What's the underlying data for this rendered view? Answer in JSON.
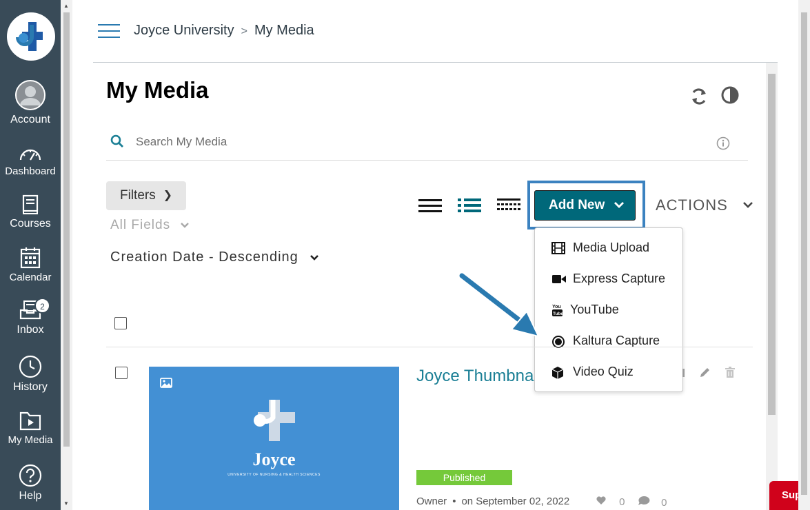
{
  "colors": {
    "nav_bg": "#394b58",
    "accent_teal": "#00687a",
    "link_teal": "#1b7f95",
    "highlight_blue": "#3b82c0",
    "published_green": "#75c93a",
    "thumbnail_blue": "#4390d4"
  },
  "global_nav": {
    "logo_icon": "joyce-cross-logo",
    "items": [
      {
        "label": "Account",
        "icon": "avatar-icon"
      },
      {
        "label": "Dashboard",
        "icon": "speedometer-icon"
      },
      {
        "label": "Courses",
        "icon": "book-icon"
      },
      {
        "label": "Calendar",
        "icon": "calendar-icon"
      },
      {
        "label": "Inbox",
        "icon": "inbox-icon",
        "badge": "2"
      },
      {
        "label": "History",
        "icon": "clock-icon"
      },
      {
        "label": "My Media",
        "icon": "media-folder-icon"
      },
      {
        "label": "Help",
        "icon": "help-icon"
      }
    ]
  },
  "header": {
    "breadcrumb": [
      "Joyce University",
      "My Media"
    ],
    "separator": ">"
  },
  "main": {
    "title": "My Media",
    "search": {
      "placeholder": "Search My Media"
    },
    "filters_label": "Filters",
    "field_select": "All Fields",
    "sort_select": "Creation Date - Descending",
    "add_new_label": "Add New",
    "actions_label": "ACTIONS",
    "add_new_menu": [
      {
        "label": "Media Upload",
        "icon": "film-icon"
      },
      {
        "label": "Express Capture",
        "icon": "video-camera-icon"
      },
      {
        "label": "YouTube",
        "icon": "youtube-icon"
      },
      {
        "label": "Kaltura Capture",
        "icon": "record-icon"
      },
      {
        "label": "Video Quiz",
        "icon": "cube-icon"
      }
    ]
  },
  "entries": [
    {
      "title": "Joyce Thumbnail",
      "status": "Published",
      "owner": "Owner",
      "date": "on September 02, 2022",
      "likes": "0",
      "comments": "0",
      "thumbnail_brand": "Joyce",
      "thumbnail_subtitle": "UNIVERSITY OF NURSING & HEALTH SCIENCES"
    }
  ],
  "support_tab_label": "Sup"
}
